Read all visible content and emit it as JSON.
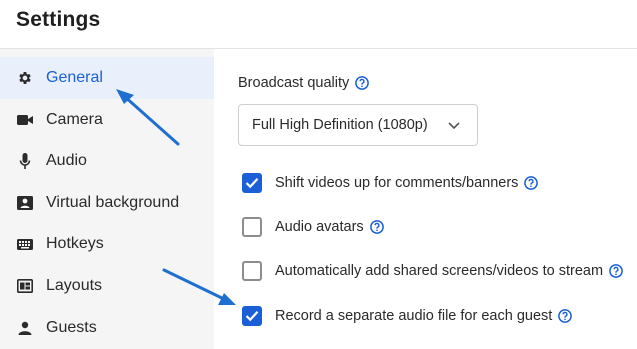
{
  "header": {
    "title": "Settings"
  },
  "sidebar": {
    "items": [
      {
        "label": "General",
        "icon": "gear-icon",
        "active": true
      },
      {
        "label": "Camera",
        "icon": "camera-icon",
        "active": false
      },
      {
        "label": "Audio",
        "icon": "microphone-icon",
        "active": false
      },
      {
        "label": "Virtual background",
        "icon": "virtual-background-icon",
        "active": false
      },
      {
        "label": "Hotkeys",
        "icon": "keyboard-icon",
        "active": false
      },
      {
        "label": "Layouts",
        "icon": "layout-icon",
        "active": false
      },
      {
        "label": "Guests",
        "icon": "person-icon",
        "active": false
      }
    ]
  },
  "main": {
    "broadcast_quality_label": "Broadcast quality",
    "broadcast_quality_value": "Full High Definition (1080p)",
    "options": [
      {
        "label": "Shift videos up for comments/banners",
        "checked": true
      },
      {
        "label": "Audio avatars",
        "checked": false
      },
      {
        "label": "Automatically add shared screens/videos to stream",
        "checked": false
      },
      {
        "label": "Record a separate audio file for each guest",
        "checked": true
      }
    ]
  },
  "colors": {
    "accent": "#1a5fd6",
    "annotation_arrow": "#1f6fd0",
    "sidebar_bg": "#f5f5f5",
    "active_item_bg": "#e9f0fb"
  }
}
